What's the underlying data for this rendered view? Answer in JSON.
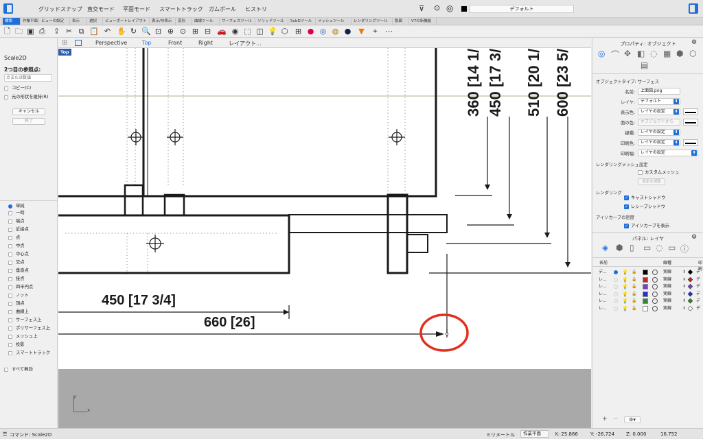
{
  "menubar": {
    "items": [
      "グリッドスナップ",
      "直交モード",
      "平面モード",
      "スマートトラック",
      "ガムボール",
      "ヒストリ"
    ],
    "layer_display": "デフォルト"
  },
  "tabs": [
    "標準",
    "作業平面",
    "ビューの設定",
    "表示",
    "選択",
    "ビューポートレイアウト",
    "表示/非表示",
    "変形",
    "曲線ツール",
    "サーフェスツール",
    "ソリッドツール",
    "SubDツール",
    "メッシュツール",
    "レンダリングツール",
    "製図",
    "V7の新機能"
  ],
  "viewport_tabs": [
    "Perspective",
    "Top",
    "Front",
    "Right",
    "レイアウト..."
  ],
  "viewport_label": "Top",
  "left_panel": {
    "command": "Scale2D",
    "prompt": "2つ目の参照点:",
    "input_placeholder": "点または数値",
    "copy_option": "コピー(C)",
    "keep_shape_option": "元の形状を維持(R)",
    "cancel": "キャンセル",
    "finish": "終了",
    "snaps": [
      "単純",
      "一時",
      "端点",
      "近接点",
      "点",
      "中点",
      "中心点",
      "交点",
      "垂直点",
      "接点",
      "四半円点",
      "ノット",
      "頂点",
      "曲線上",
      "サーフェス上",
      "ポリサーフェス上",
      "メッシュ上",
      "投影",
      "スマートトラック"
    ],
    "disable_all": "すべて無効"
  },
  "drawing": {
    "dims_vertical": [
      "360 [14 1/",
      "450 [17 3/",
      "510 [20 1/",
      "600 [23 5/"
    ],
    "dim_450": "450 [17 3/4]",
    "dim_660": "660 [26]"
  },
  "axes": {
    "x": "x",
    "y": "y"
  },
  "properties": {
    "title": "プロパティ: オブジェクト",
    "object_type": "オブジェクトタイプ: サーフェス",
    "fields": [
      {
        "label": "名前:",
        "value": "上面図.png",
        "kind": "text"
      },
      {
        "label": "レイヤ:",
        "value": "デフォルト",
        "kind": "select"
      },
      {
        "label": "表示色:",
        "value": "レイヤの設定",
        "kind": "select",
        "swatch": true
      },
      {
        "label": "面の色:",
        "value": "オブジェクトから",
        "kind": "disabled",
        "swatch": true
      },
      {
        "label": "線種:",
        "value": "レイヤの設定",
        "kind": "select"
      },
      {
        "label": "印刷色:",
        "value": "レイヤの設定",
        "kind": "select",
        "swatch": true
      },
      {
        "label": "印刷幅:",
        "value": "レイヤの設定",
        "kind": "select"
      }
    ],
    "render_mesh_section": "レンダリングメッシュ設定",
    "custom_mesh": "カスタムメッシュ",
    "adjust_button": "設定を調整",
    "rendering_section": "レンダリング",
    "cast_shadows": "キャストシャドウ",
    "receive_shadows": "レシーブシャドウ",
    "isocurve_section": "アイソカーブの密度",
    "show_isocurves": "アイソカーブを表示"
  },
  "layers_panel": {
    "title": "パネル: レイヤ",
    "col_name": "名前",
    "col_linetype": "線種",
    "col_print": "印刷",
    "rows": [
      {
        "name": "デ...",
        "color": "#000000",
        "linetype": "実線",
        "current": true
      },
      {
        "name": "レ...",
        "color": "#c0282b",
        "linetype": "実線"
      },
      {
        "name": "レ...",
        "color": "#7a3fc2",
        "linetype": "実線"
      },
      {
        "name": "レ...",
        "color": "#2036c8",
        "linetype": "実線"
      },
      {
        "name": "レ...",
        "color": "#2f8a2f",
        "linetype": "実線"
      },
      {
        "name": "レ...",
        "color": "#ffffff",
        "linetype": "実線"
      }
    ],
    "row_suffix": "デ"
  },
  "statusbar": {
    "command": "コマンド: Scale2D",
    "units": "ミリメートル",
    "cplane": "作業平面",
    "x": "X: 25.866",
    "y": "Y: -26.724",
    "z": "Z: 0.000",
    "value": "16.752"
  },
  "colors": {
    "accent": "#1f6fd6",
    "highlight_circle": "#e0301e",
    "grid": "#a9a9a9"
  }
}
